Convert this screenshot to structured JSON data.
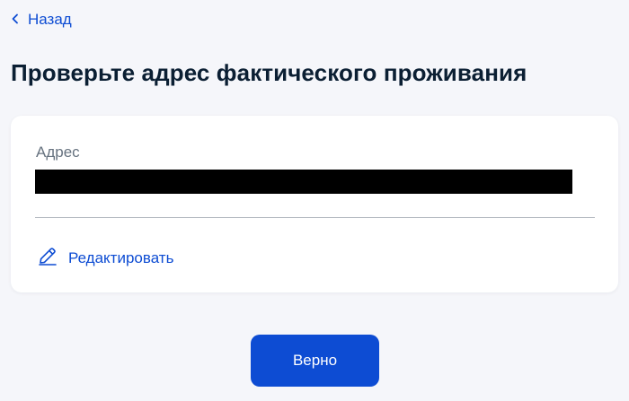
{
  "nav": {
    "back_label": "Назад",
    "back_icon": "chevron-left-icon"
  },
  "page": {
    "title": "Проверьте адрес фактического проживания"
  },
  "address_card": {
    "field_label": "Адрес",
    "field_value": "",
    "edit_label": "Редактировать",
    "edit_icon": "pencil-icon"
  },
  "actions": {
    "confirm_label": "Верно"
  },
  "colors": {
    "accent": "#0d4cd3",
    "title": "#0b1f33",
    "label": "#66727f",
    "background": "#f5f6fa",
    "card": "#ffffff",
    "divider": "#b3b8c0"
  }
}
